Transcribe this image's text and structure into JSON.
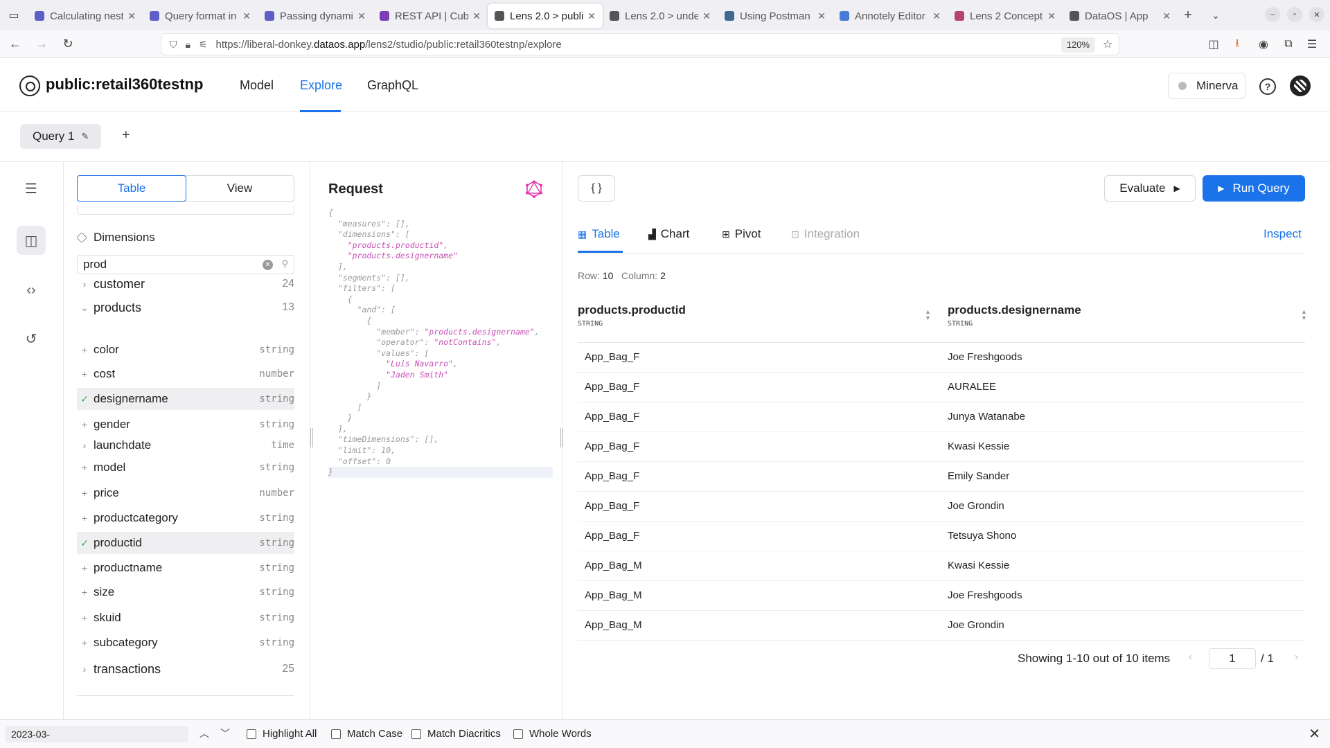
{
  "browser": {
    "tabs": [
      {
        "title": "Calculating nest",
        "color": "#5b5fc7"
      },
      {
        "title": "Query format in",
        "color": "#5b5fc7"
      },
      {
        "title": "Passing dynami",
        "color": "#5b5fc7"
      },
      {
        "title": "REST API | Cube",
        "color": "#7a3fb5"
      },
      {
        "title": "Lens 2.0 > publi",
        "color": "#555555",
        "active": true
      },
      {
        "title": "Lens 2.0 > unde",
        "color": "#555555"
      },
      {
        "title": "Using Postman",
        "color": "#3d6b8f"
      },
      {
        "title": "Annotely Editor",
        "color": "#4a7bd6"
      },
      {
        "title": "Lens 2 Concept",
        "color": "#b5466b"
      },
      {
        "title": "DataOS | App",
        "color": "#555555"
      }
    ],
    "url_prefix": "https://liberal-donkey.",
    "url_domain": "dataos.app",
    "url_path": "/lens2/studio/public:retail360testnp/explore",
    "zoom": "120%"
  },
  "app": {
    "name": "public:retail360testnp",
    "nav": [
      "Model",
      "Explore",
      "GraphQL"
    ],
    "active_nav": "Explore",
    "env": "Minerva",
    "help": "?"
  },
  "query": {
    "tab_label": "Query 1",
    "add": "+"
  },
  "schema": {
    "segment": [
      "Table",
      "View"
    ],
    "dimensions_label": "Dimensions",
    "search_value": "prod",
    "groups": [
      {
        "name": "customer",
        "count": "24",
        "expanded": false
      },
      {
        "name": "products",
        "count": "13",
        "expanded": true
      }
    ],
    "fields": [
      {
        "name": "color",
        "type": "string",
        "selected": false,
        "kind": "plus"
      },
      {
        "name": "cost",
        "type": "number",
        "selected": false,
        "kind": "plus"
      },
      {
        "name": "designername",
        "type": "string",
        "selected": true,
        "kind": "check"
      },
      {
        "name": "gender",
        "type": "string",
        "selected": false,
        "kind": "plus"
      },
      {
        "name": "launchdate",
        "type": "time",
        "selected": false,
        "kind": "chevron"
      },
      {
        "name": "model",
        "type": "string",
        "selected": false,
        "kind": "plus"
      },
      {
        "name": "price",
        "type": "number",
        "selected": false,
        "kind": "plus"
      },
      {
        "name": "productcategory",
        "type": "string",
        "selected": false,
        "kind": "plus"
      },
      {
        "name": "productid",
        "type": "string",
        "selected": true,
        "kind": "check"
      },
      {
        "name": "productname",
        "type": "string",
        "selected": false,
        "kind": "plus"
      },
      {
        "name": "size",
        "type": "string",
        "selected": false,
        "kind": "plus"
      },
      {
        "name": "skuid",
        "type": "string",
        "selected": false,
        "kind": "plus"
      },
      {
        "name": "subcategory",
        "type": "string",
        "selected": false,
        "kind": "plus"
      }
    ],
    "footer_group": {
      "name": "transactions",
      "count": "25"
    }
  },
  "request": {
    "title": "Request",
    "code_lines": [
      "{",
      "  \"measures\": [],",
      "  \"dimensions\": [",
      "    \"products.productid\",",
      "    \"products.designername\"",
      "  ],",
      "  \"segments\": [],",
      "  \"filters\": [",
      "    {",
      "      \"and\": [",
      "        {",
      "          \"member\": \"products.designername\",",
      "          \"operator\": \"notContains\",",
      "          \"values\": [",
      "            \"Luis Navarro\",",
      "            \"Jaden Smith\"",
      "          ]",
      "        }",
      "      ]",
      "    }",
      "  ],",
      "  \"timeDimensions\": [],",
      "  \"limit\": 10,",
      "  \"offset\": 0",
      "}"
    ]
  },
  "results": {
    "braces": "{ }",
    "evaluate": "Evaluate",
    "run": "Run Query",
    "tabs": [
      "Table",
      "Chart",
      "Pivot",
      "Integration"
    ],
    "inspect": "Inspect",
    "row_label": "Row:",
    "row_value": "10",
    "col_label": "Column:",
    "col_value": "2",
    "columns": [
      {
        "name": "products.productid",
        "type": "STRING"
      },
      {
        "name": "products.designername",
        "type": "STRING"
      }
    ],
    "rows": [
      [
        "App_Bag_F",
        "Joe Freshgoods"
      ],
      [
        "App_Bag_F",
        "AURALEE"
      ],
      [
        "App_Bag_F",
        "Junya Watanabe"
      ],
      [
        "App_Bag_F",
        "Kwasi Kessie"
      ],
      [
        "App_Bag_F",
        "Emily Sander"
      ],
      [
        "App_Bag_F",
        "Joe Grondin"
      ],
      [
        "App_Bag_F",
        "Tetsuya Shono"
      ],
      [
        "App_Bag_M",
        "Kwasi Kessie"
      ],
      [
        "App_Bag_M",
        "Joe Freshgoods"
      ],
      [
        "App_Bag_M",
        "Joe Grondin"
      ]
    ],
    "pager_info": "Showing 1-10 out of 10 items",
    "page": "1",
    "total_pages": "/  1"
  },
  "findbar": {
    "value": "2023-03-",
    "options": [
      "Highlight All",
      "Match Case",
      "Match Diacritics",
      "Whole Words"
    ]
  }
}
